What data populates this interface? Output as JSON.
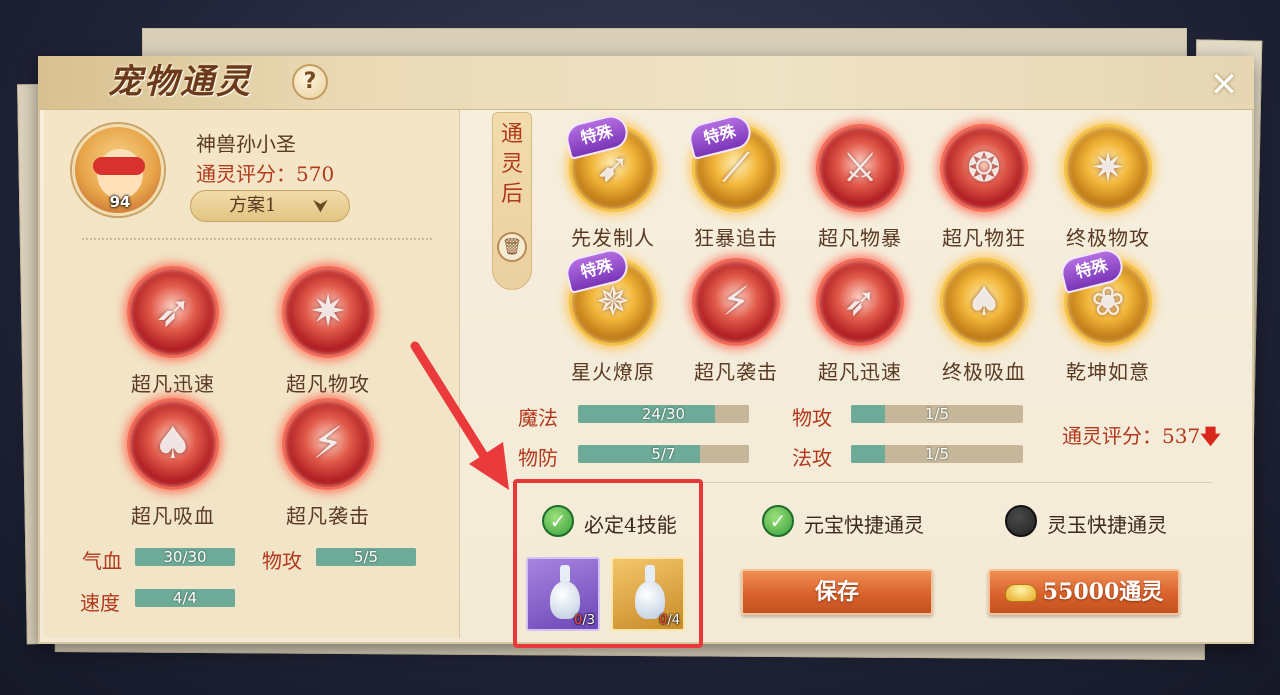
{
  "window": {
    "title": "宠物通灵",
    "help_label": "?",
    "close_label": "✕"
  },
  "pet": {
    "name": "神兽孙小圣",
    "score_text": "通灵评分：570",
    "level": "94",
    "plan_label": "方案1",
    "plan_chevron": "⮟"
  },
  "current_skills": [
    {
      "name": "超凡迅速",
      "icon": "dash-icon"
    },
    {
      "name": "超凡物攻",
      "icon": "sword-burst-icon"
    },
    {
      "name": "超凡吸血",
      "icon": "bat-icon"
    },
    {
      "name": "超凡袭击",
      "icon": "claw-icon"
    }
  ],
  "current_stats": [
    {
      "label": "气血",
      "value": "30/30",
      "fill": 1.0
    },
    {
      "label": "物攻",
      "value": "5/5",
      "fill": 1.0
    },
    {
      "label": "速度",
      "value": "4/4",
      "fill": 1.0
    }
  ],
  "after": {
    "tab_label": "通灵后",
    "delete_icon": "trash-icon",
    "skills": [
      {
        "name": "先发制人",
        "special": true,
        "tier": "gold",
        "icon": "spear-icon"
      },
      {
        "name": "狂暴追击",
        "special": true,
        "tier": "gold",
        "icon": "slash-icon"
      },
      {
        "name": "超凡物暴",
        "special": false,
        "tier": "red",
        "icon": "sword-icon"
      },
      {
        "name": "超凡物狂",
        "special": false,
        "tier": "red",
        "icon": "sword-flame-icon"
      },
      {
        "name": "终极物攻",
        "special": false,
        "tier": "gold",
        "icon": "sword-burst-icon"
      },
      {
        "name": "星火燎原",
        "special": true,
        "tier": "gold",
        "icon": "sparks-icon"
      },
      {
        "name": "超凡袭击",
        "special": false,
        "tier": "red",
        "icon": "claw-icon"
      },
      {
        "name": "超凡迅速",
        "special": false,
        "tier": "red",
        "icon": "dash-icon"
      },
      {
        "name": "终极吸血",
        "special": false,
        "tier": "gold",
        "icon": "bat-icon"
      },
      {
        "name": "乾坤如意",
        "special": true,
        "tier": "gold",
        "icon": "swirl-icon"
      }
    ],
    "special_badge": "特殊",
    "stats": [
      {
        "label": "魔法",
        "value": "24/30",
        "fill": 0.8
      },
      {
        "label": "物攻",
        "value": "1/5",
        "fill": 0.2
      },
      {
        "label": "物防",
        "value": "5/7",
        "fill": 0.714
      },
      {
        "label": "法攻",
        "value": "1/5",
        "fill": 0.2
      }
    ],
    "score_text": "通灵评分：537",
    "score_trend_icon": "🡇"
  },
  "options": {
    "guarantee_label": "必定4技能",
    "guarantee_checked": true,
    "yuanbao_label": "元宝快捷通灵",
    "yuanbao_checked": true,
    "lingyu_label": "灵玉快捷通灵",
    "lingyu_checked": false,
    "check_glyph": "✓"
  },
  "items": [
    {
      "name": "purple-vase",
      "have": "0",
      "need": "/3"
    },
    {
      "name": "gold-vase",
      "have": "0",
      "need": "/4"
    }
  ],
  "actions": {
    "save_label": "保存",
    "spirit_label": "55000通灵"
  },
  "colors": {
    "accent_red": "#b2381d",
    "bar_fill": "#6dab98",
    "highlight": "#e8383a",
    "button_orange": "#d9622d"
  }
}
